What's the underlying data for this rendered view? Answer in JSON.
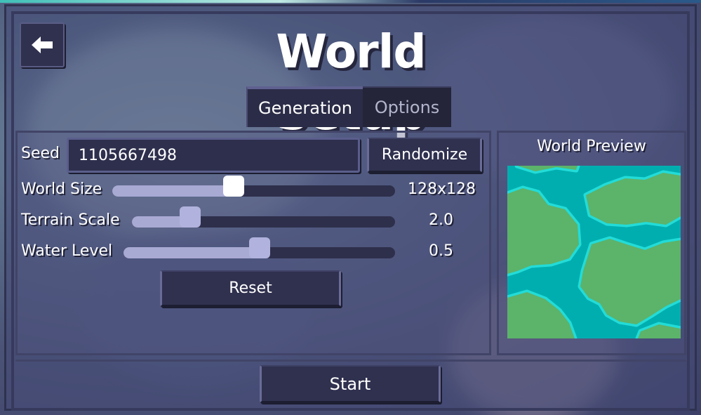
{
  "window": {
    "title": "World Setup"
  },
  "back_button": {
    "icon": "arrow-left-icon"
  },
  "tabs": [
    {
      "label": "Generation",
      "active": true
    },
    {
      "label": "Options",
      "active": false
    }
  ],
  "generation": {
    "seed": {
      "label": "Seed",
      "value": "1105667498"
    },
    "randomize_label": "Randomize",
    "world_size": {
      "label": "World Size",
      "value": "128x128",
      "level": 0.43
    },
    "terrain_scale": {
      "label": "Terrain Scale",
      "value": "2.0",
      "level": 0.22
    },
    "water_level": {
      "label": "Water Level",
      "value": "0.5",
      "level": 0.5
    },
    "reset_label": "Reset"
  },
  "preview": {
    "title": "World Preview",
    "colors": {
      "water": "#00aeb0",
      "shore": "#22dcd8",
      "land": "#5cb36a"
    }
  },
  "start_label": "Start",
  "theme": {
    "panel": "#30314f",
    "slider_fill": "#a9aad4",
    "accent_border": "#6a6c98"
  }
}
